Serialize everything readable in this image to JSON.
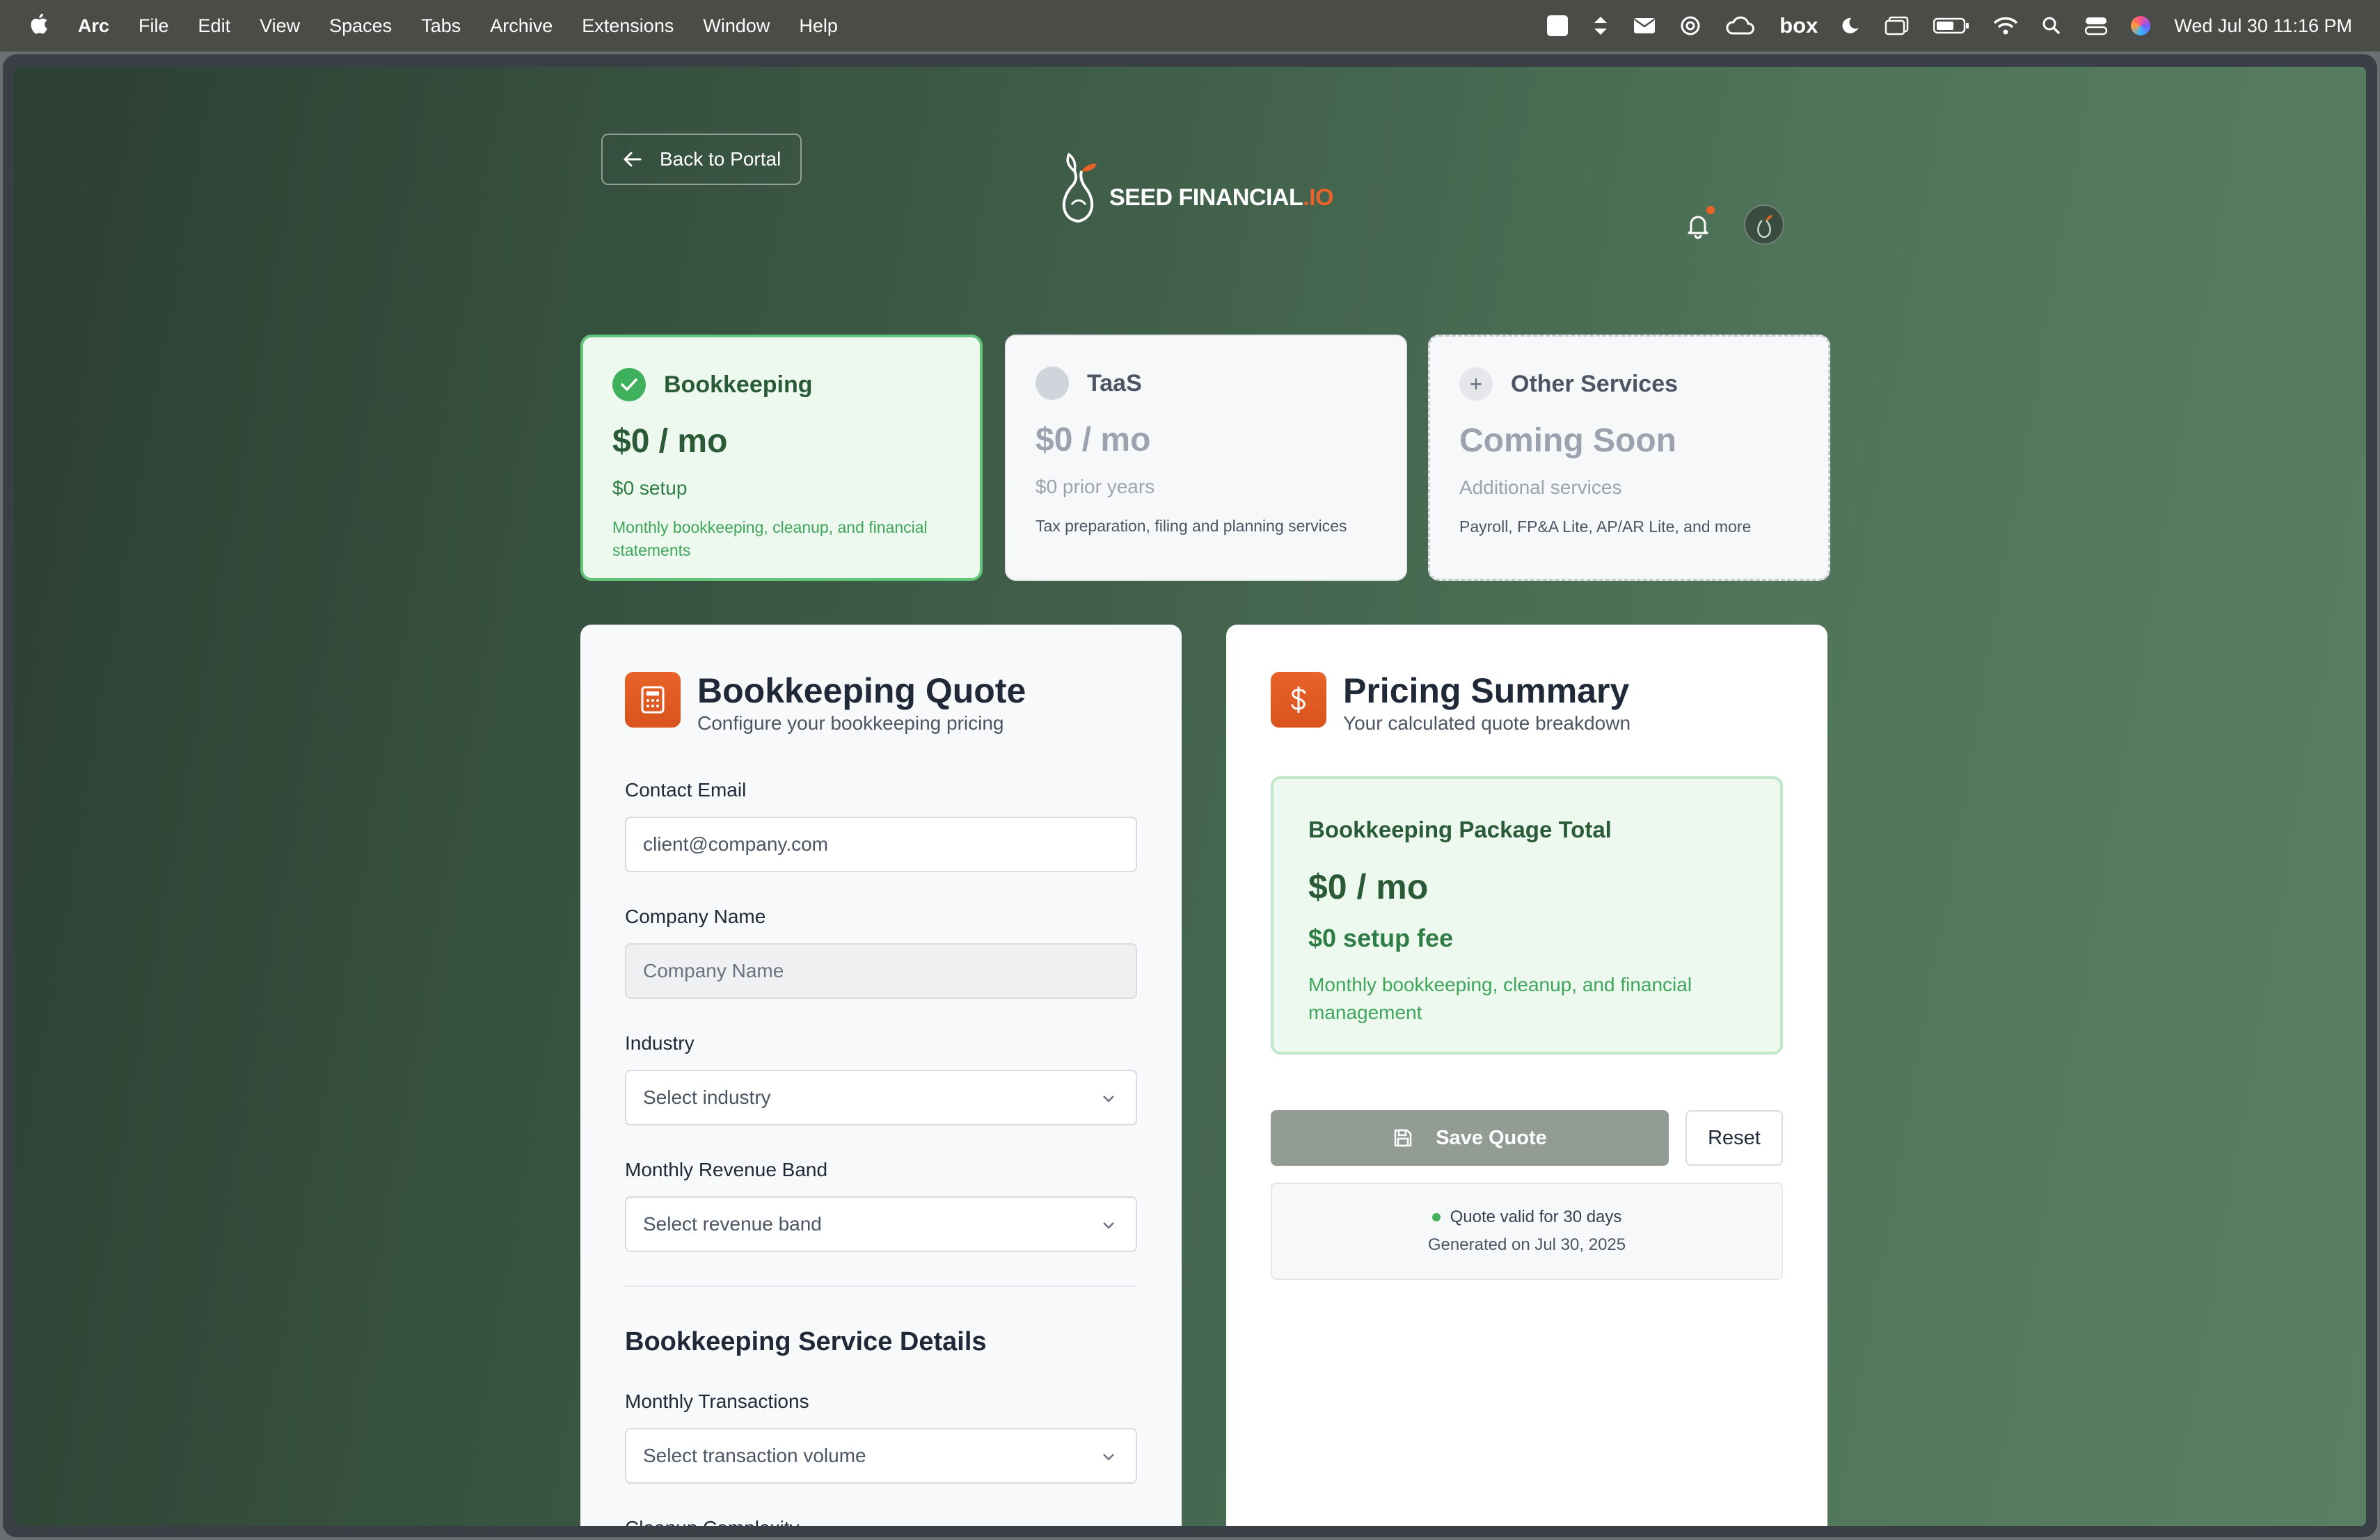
{
  "menubar": {
    "app_name": "Arc",
    "menus": [
      "File",
      "Edit",
      "View",
      "Spaces",
      "Tabs",
      "Archive",
      "Extensions",
      "Window",
      "Help"
    ],
    "box_label": "box",
    "datetime": "Wed Jul 30  11:16 PM"
  },
  "header": {
    "back_label": "Back to Portal",
    "logo_text": "SEED FINANCIAL",
    "logo_suffix": ".IO"
  },
  "services": [
    {
      "title": "Bookkeeping",
      "price": "$0 / mo",
      "sub": "$0 setup",
      "desc": "Monthly bookkeeping, cleanup, and financial statements",
      "state": "selected"
    },
    {
      "title": "TaaS",
      "price": "$0 / mo",
      "sub": "$0 prior years",
      "desc": "Tax preparation, filing and planning services",
      "state": "unselected"
    },
    {
      "title": "Other Services",
      "price": "Coming Soon",
      "sub": "Additional services",
      "desc": "Payroll, FP&A Lite, AP/AR Lite, and more",
      "state": "disabled"
    }
  ],
  "quote_form": {
    "title": "Bookkeeping Quote",
    "subtitle": "Configure your bookkeeping pricing",
    "fields": {
      "email": {
        "label": "Contact Email",
        "placeholder": "client@company.com"
      },
      "company": {
        "label": "Company Name",
        "placeholder": "Company Name"
      },
      "industry": {
        "label": "Industry",
        "placeholder": "Select industry"
      },
      "revenue": {
        "label": "Monthly Revenue Band",
        "placeholder": "Select revenue band"
      }
    },
    "section_title": "Bookkeeping Service Details",
    "transactions": {
      "label": "Monthly Transactions",
      "placeholder": "Select transaction volume"
    },
    "cleanup_label": "Cleanup Complexity"
  },
  "summary": {
    "title": "Pricing Summary",
    "subtitle": "Your calculated quote breakdown",
    "package_title": "Bookkeeping Package Total",
    "package_price": "$0 / mo",
    "package_setup": "$0 setup fee",
    "package_desc": "Monthly bookkeeping, cleanup, and financial management",
    "save_label": "Save Quote",
    "reset_label": "Reset",
    "valid_text": "Quote valid for 30 days",
    "generated_text": "Generated on Jul 30, 2025"
  },
  "colors": {
    "accent": "#e8622a",
    "green": "#3fb15c",
    "dark_green": "#2b5a37"
  }
}
